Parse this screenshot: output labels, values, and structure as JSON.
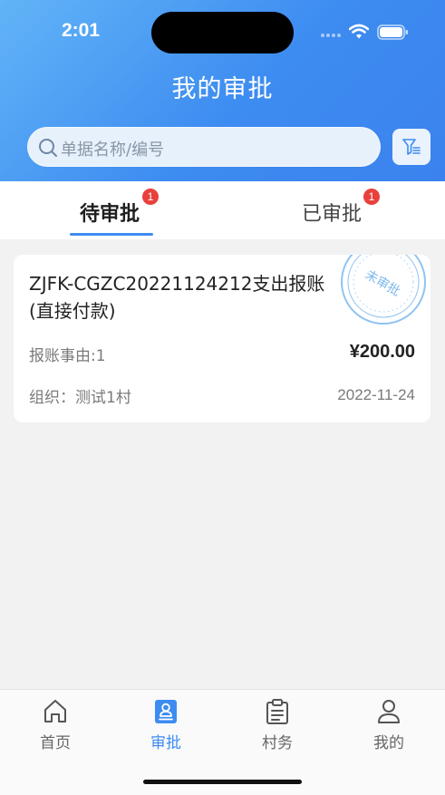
{
  "status_bar": {
    "time": "2:01"
  },
  "header": {
    "title": "我的审批"
  },
  "search": {
    "placeholder": "单据名称/编号"
  },
  "tabs": [
    {
      "label": "待审批",
      "badge": "1",
      "active": true
    },
    {
      "label": "已审批",
      "badge": "1",
      "active": false
    }
  ],
  "records": [
    {
      "title": "ZJFK-CGZC20221124212支出报账(直接付款)",
      "reason": "报账事由:1",
      "amount": "¥200.00",
      "org": "组织：测试1村",
      "date": "2022-11-24",
      "stamp": "未审批"
    }
  ],
  "tabbar": [
    {
      "label": "首页",
      "icon": "home-icon",
      "active": false
    },
    {
      "label": "审批",
      "icon": "approval-icon",
      "active": true
    },
    {
      "label": "村务",
      "icon": "clipboard-icon",
      "active": false
    },
    {
      "label": "我的",
      "icon": "profile-icon",
      "active": false
    }
  ],
  "colors": {
    "primary": "#3d8cf1",
    "badge": "#e8413b",
    "stamp": "#8fc3f2"
  }
}
